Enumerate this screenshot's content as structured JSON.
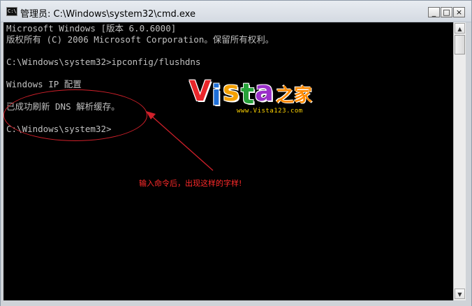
{
  "window": {
    "title": "管理员: C:\\Windows\\system32\\cmd.exe",
    "icon_label": "C:\\",
    "buttons": {
      "minimize": "_",
      "maximize": "□",
      "close": "×"
    }
  },
  "console": {
    "lines": [
      "Microsoft Windows [版本 6.0.6000]",
      "版权所有 (C) 2006 Microsoft Corporation。保留所有权利。",
      "",
      "C:\\Windows\\system32>ipconfig/flushdns",
      "",
      "Windows IP 配置",
      "",
      "已成功刷新 DNS 解析缓存。",
      "",
      "C:\\Windows\\system32>"
    ]
  },
  "annotation": {
    "text": "输入命令后，出现这样的字样!",
    "color": "#ff2a2a"
  },
  "watermark": {
    "letters": [
      "V",
      "i",
      "s",
      "t",
      "a"
    ],
    "letter_colors": [
      "#e8262a",
      "#1e6fd8",
      "#f4a000",
      "#27a23a",
      "#9b2fc9"
    ],
    "cn_text": "之家",
    "url": "www.Vista123.com"
  },
  "scrollbar": {
    "up_icon": "▲",
    "down_icon": "▼"
  }
}
